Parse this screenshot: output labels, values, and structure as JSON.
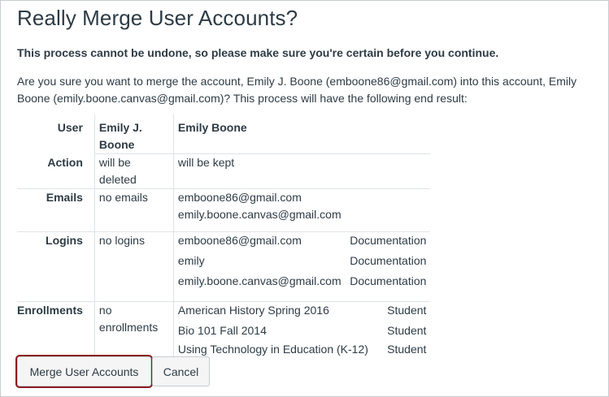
{
  "title": "Really Merge User Accounts?",
  "warning": "This process cannot be undone, so please make sure you're certain before you continue.",
  "description": "Are you sure you want to merge the account, Emily J. Boone (emboone86@gmail.com) into this account, Emily Boone (emily.boone.canvas@gmail.com)? This process will have the following end result:",
  "table": {
    "headers": {
      "user": "User",
      "source": "Emily J. Boone",
      "target": "Emily Boone"
    },
    "action": {
      "label": "Action",
      "source": "will be deleted",
      "target": "will be kept"
    },
    "emails": {
      "label": "Emails",
      "source": "no emails",
      "target": [
        "emboone86@gmail.com",
        "emily.boone.canvas@gmail.com"
      ]
    },
    "logins": {
      "label": "Logins",
      "source": "no logins",
      "target": [
        {
          "login": "emboone86@gmail.com",
          "type": "Documentation"
        },
        {
          "login": "emily",
          "type": "Documentation"
        },
        {
          "login": "emily.boone.canvas@gmail.com",
          "type": "Documentation"
        }
      ]
    },
    "enrollments": {
      "label": "Enrollments",
      "source": "no enrollments",
      "target": [
        {
          "course": "American History Spring 2016",
          "role": "Student"
        },
        {
          "course": "Bio 101 Fall 2014",
          "role": "Student"
        },
        {
          "course": "Using Technology in Education (K-12)",
          "role": "Student"
        }
      ]
    }
  },
  "buttons": {
    "merge": "Merge User Accounts",
    "cancel": "Cancel"
  },
  "colors": {
    "text": "#2d3b45",
    "focus_ring": "#8b1c1f",
    "border": "#c7cdd1"
  }
}
